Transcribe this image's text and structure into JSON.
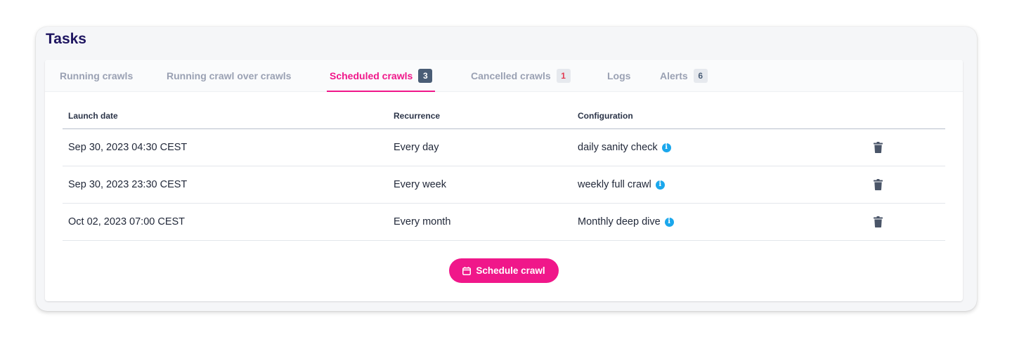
{
  "page": {
    "title": "Tasks"
  },
  "tabs": [
    {
      "label": "Running crawls",
      "badge": null
    },
    {
      "label": "Running crawl over crawls",
      "badge": null
    },
    {
      "label": "Scheduled crawls",
      "badge": "3",
      "active": true
    },
    {
      "label": "Cancelled crawls",
      "badge": "1"
    },
    {
      "label": "Logs",
      "badge": null
    },
    {
      "label": "Alerts",
      "badge": "6"
    }
  ],
  "table": {
    "headers": [
      "Launch date",
      "Recurrence",
      "Configuration"
    ],
    "rows": [
      {
        "launch_date": "Sep 30, 2023 04:30 CEST",
        "recurrence": "Every day",
        "configuration": "daily sanity check"
      },
      {
        "launch_date": "Sep 30, 2023 23:30 CEST",
        "recurrence": "Every week",
        "configuration": "weekly full crawl"
      },
      {
        "launch_date": "Oct 02, 2023 07:00 CEST",
        "recurrence": "Every month",
        "configuration": "Monthly deep dive"
      }
    ]
  },
  "actions": {
    "schedule_label": "Schedule crawl"
  },
  "icons": {
    "info": "info-icon",
    "delete": "trash-icon",
    "calendar": "calendar-icon"
  },
  "colors": {
    "accent": "#f0178a",
    "title": "#1e1560",
    "info": "#1aa7ec",
    "badge_dark": "#4a5d76"
  }
}
